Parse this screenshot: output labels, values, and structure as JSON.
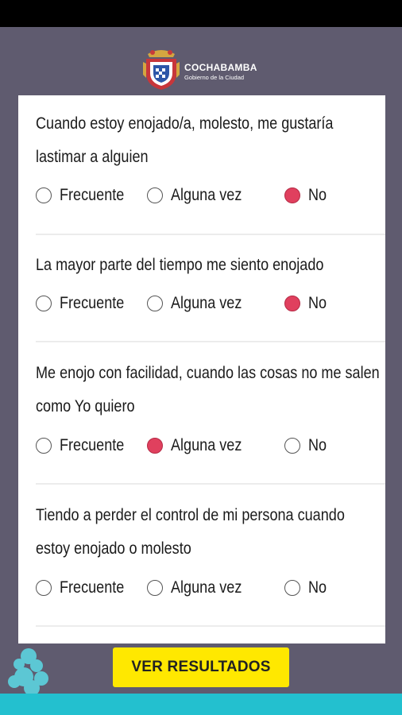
{
  "header": {
    "logo_name": "COCHABAMBA",
    "logo_sub": "Gobierno de la Ciudad"
  },
  "questions": [
    {
      "text": "Cuando estoy enojado/a, molesto, me gustaría lastimar a alguien",
      "options": [
        "Frecuente",
        "Alguna vez",
        "No"
      ],
      "selected": "No"
    },
    {
      "text": "La mayor parte del tiempo me siento enojado",
      "options": [
        "Frecuente",
        "Alguna vez",
        "No"
      ],
      "selected": "No"
    },
    {
      "text": "Me enojo con facilidad, cuando las cosas no me salen como Yo quiero",
      "options": [
        "Frecuente",
        "Alguna vez",
        "No"
      ],
      "selected": "Alguna vez"
    },
    {
      "text": "Tiendo a perder el control de mi persona cuando estoy enojado o molesto",
      "options": [
        "Frecuente",
        "Alguna vez",
        "No"
      ],
      "selected": null
    }
  ],
  "footer": {
    "button_label": "VER RESULTADOS"
  },
  "colors": {
    "background": "#5f5b6f",
    "radio_selected": "#e0405e",
    "button": "#ffe800",
    "bottom_bar": "#23c0cf"
  }
}
